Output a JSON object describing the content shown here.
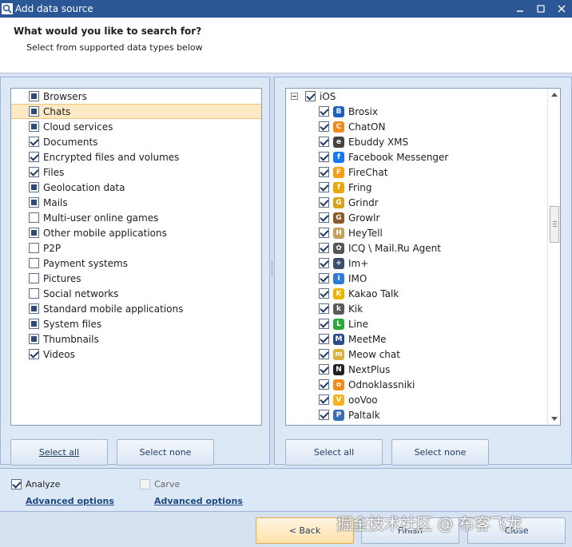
{
  "window": {
    "title": "Add data source"
  },
  "header": {
    "question": "What would you like to search for?",
    "subtitle": "Select from supported data types below"
  },
  "left": {
    "items": [
      {
        "label": "Browsers",
        "state": "partial"
      },
      {
        "label": "Chats",
        "state": "partial",
        "selected": true
      },
      {
        "label": "Cloud services",
        "state": "partial"
      },
      {
        "label": "Documents",
        "state": "checked"
      },
      {
        "label": "Encrypted files and volumes",
        "state": "checked"
      },
      {
        "label": "Files",
        "state": "checked"
      },
      {
        "label": "Geolocation data",
        "state": "partial"
      },
      {
        "label": "Mails",
        "state": "partial"
      },
      {
        "label": "Multi-user online games",
        "state": "unchecked"
      },
      {
        "label": "Other mobile applications",
        "state": "partial"
      },
      {
        "label": "P2P",
        "state": "unchecked"
      },
      {
        "label": "Payment systems",
        "state": "unchecked"
      },
      {
        "label": "Pictures",
        "state": "unchecked"
      },
      {
        "label": "Social networks",
        "state": "unchecked"
      },
      {
        "label": "Standard mobile applications",
        "state": "partial"
      },
      {
        "label": "System files",
        "state": "partial"
      },
      {
        "label": "Thumbnails",
        "state": "partial"
      },
      {
        "label": "Videos",
        "state": "checked"
      }
    ],
    "select_all": "Select all",
    "select_none": "Select none"
  },
  "right": {
    "parent": {
      "label": "iOS",
      "state": "checked"
    },
    "items": [
      {
        "label": "Brosix",
        "icon": "brosix-icon",
        "color": "#1f5fbf",
        "glyph": "B"
      },
      {
        "label": "ChatON",
        "icon": "chaton-icon",
        "color": "#f08a1c",
        "glyph": "C"
      },
      {
        "label": "Ebuddy XMS",
        "icon": "ebuddy-icon",
        "color": "#444444",
        "glyph": "e"
      },
      {
        "label": "Facebook Messenger",
        "icon": "messenger-icon",
        "color": "#1877f2",
        "glyph": "f"
      },
      {
        "label": "FireChat",
        "icon": "firechat-icon",
        "color": "#f4a018",
        "glyph": "F"
      },
      {
        "label": "Fring",
        "icon": "fring-icon",
        "color": "#e8a80c",
        "glyph": "f"
      },
      {
        "label": "Grindr",
        "icon": "grindr-icon",
        "color": "#d8a21a",
        "glyph": "G"
      },
      {
        "label": "Growlr",
        "icon": "growlr-icon",
        "color": "#8a5a2a",
        "glyph": "G"
      },
      {
        "label": "HeyTell",
        "icon": "heytell-icon",
        "color": "#c5a15a",
        "glyph": "H"
      },
      {
        "label": "ICQ \\ Mail.Ru Agent",
        "icon": "icq-icon",
        "color": "#555555",
        "glyph": "✿"
      },
      {
        "label": "Im+",
        "icon": "implus-icon",
        "color": "#3c4f6a",
        "glyph": "+"
      },
      {
        "label": "IMO",
        "icon": "imo-icon",
        "color": "#2d7ad8",
        "glyph": "i"
      },
      {
        "label": "Kakao Talk",
        "icon": "kakaotalk-icon",
        "color": "#f0b400",
        "glyph": "K"
      },
      {
        "label": "Kik",
        "icon": "kik-icon",
        "color": "#5a5a5a",
        "glyph": "k"
      },
      {
        "label": "Line",
        "icon": "line-icon",
        "color": "#2fa83a",
        "glyph": "L"
      },
      {
        "label": "MeetMe",
        "icon": "meetme-icon",
        "color": "#2a4c8a",
        "glyph": "M"
      },
      {
        "label": "Meow chat",
        "icon": "meowchat-icon",
        "color": "#d9b03a",
        "glyph": "m"
      },
      {
        "label": "NextPlus",
        "icon": "nextplus-icon",
        "color": "#222222",
        "glyph": "N"
      },
      {
        "label": "Odnoklassniki",
        "icon": "odnoklassniki-icon",
        "color": "#f28c1a",
        "glyph": "o"
      },
      {
        "label": "ooVoo",
        "icon": "oovoo-icon",
        "color": "#f5b21a",
        "glyph": "V"
      },
      {
        "label": "Paltalk",
        "icon": "paltalk-icon",
        "color": "#3a6fb8",
        "glyph": "P"
      }
    ],
    "select_all": "Select all",
    "select_none": "Select none"
  },
  "options": {
    "analyze": {
      "label": "Analyze",
      "checked": true
    },
    "carve": {
      "label": "Carve",
      "checked": false
    },
    "advanced_left": "Advanced options",
    "advanced_right": "Advanced options"
  },
  "footer": {
    "back": "< Back",
    "finish": "Finish",
    "close": "Close"
  },
  "watermark": "掘金技术社区 @ 布客飞龙"
}
